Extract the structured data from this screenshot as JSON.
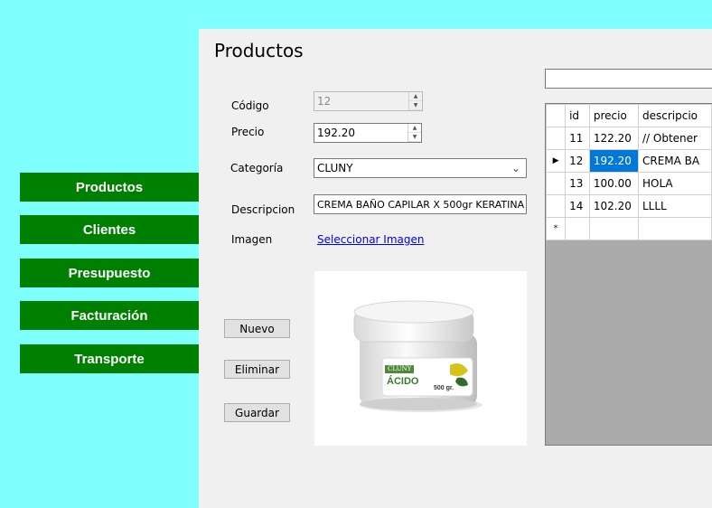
{
  "sidebar": {
    "items": [
      {
        "label": "Productos"
      },
      {
        "label": "Clientes"
      },
      {
        "label": "Presupuesto"
      },
      {
        "label": "Facturación"
      },
      {
        "label": "Transporte"
      }
    ]
  },
  "form": {
    "title": "Productos",
    "codigo_label": "Código",
    "codigo_value": "12",
    "precio_label": "Precio",
    "precio_value": "192.20",
    "categoria_label": "Categoría",
    "categoria_value": "CLUNY",
    "descripcion_label": "Descripcion",
    "descripcion_value": "CREMA BAÑO CAPILAR X 500gr KERATINA",
    "imagen_label": "Imagen",
    "imagen_link": "Seleccionar Imagen",
    "image": {
      "brand": "CLUNY",
      "name": "ÁCIDO",
      "size": "500 gr."
    }
  },
  "buttons": {
    "nuevo": "Nuevo",
    "eliminar": "Eliminar",
    "guardar": "Guardar"
  },
  "grid": {
    "headers": [
      "id",
      "precio",
      "descripcio"
    ],
    "rows": [
      {
        "id": "11",
        "precio": "122.20",
        "desc": "// Obtener"
      },
      {
        "id": "12",
        "precio": "192.20",
        "desc": "CREMA BA"
      },
      {
        "id": "13",
        "precio": "100.00",
        "desc": "HOLA"
      },
      {
        "id": "14",
        "precio": "102.20",
        "desc": "LLLL"
      }
    ],
    "selected_row_marker": "▶",
    "new_row_marker": "*"
  },
  "colors": {
    "background": "#80ffff",
    "nav": "#008000",
    "panel": "#f0f0f0",
    "selection": "#0078d7"
  }
}
